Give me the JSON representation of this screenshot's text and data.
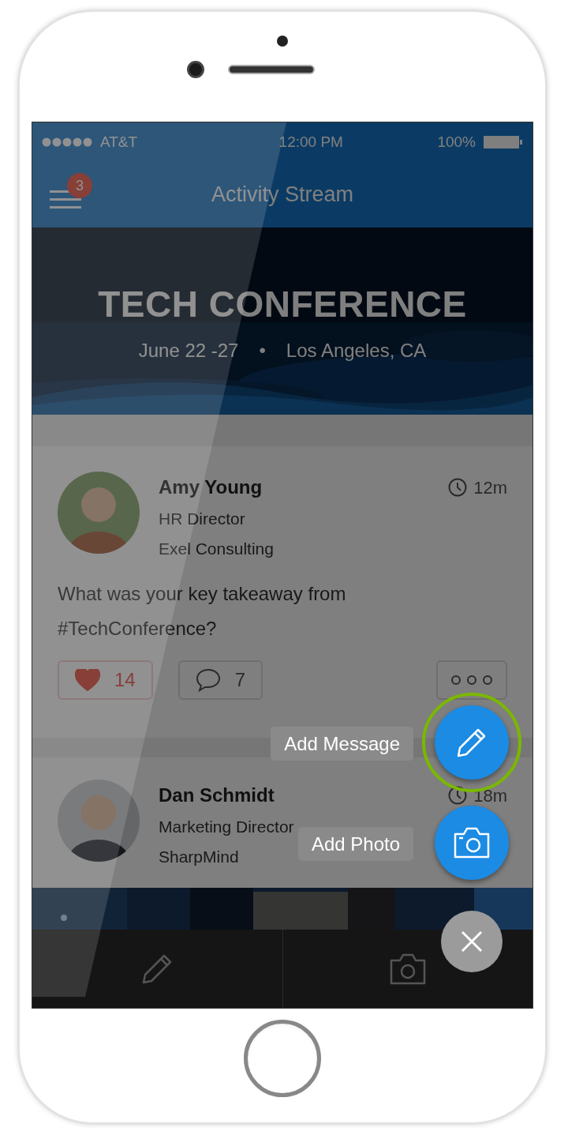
{
  "status_bar": {
    "carrier": "AT&T",
    "time": "12:00 PM",
    "battery": "100%"
  },
  "nav": {
    "title": "Activity Stream",
    "menu_badge": "3"
  },
  "banner": {
    "title": "TECH CONFERENCE",
    "dates": "June 22 -27",
    "separator": "•",
    "location": "Los Angeles, CA"
  },
  "posts": [
    {
      "name": "Amy Young",
      "role": "HR Director",
      "company": "Exel Consulting",
      "time": "12m",
      "text": "What was your key takeaway from #TechConference?",
      "likes": "14",
      "liked": true,
      "comments": "7"
    },
    {
      "name": "Dan Schmidt",
      "role": "Marketing Director",
      "company": "SharpMind",
      "time": "18m"
    }
  ],
  "fab_menu": {
    "items": [
      {
        "kind": "message",
        "label": "Add Message",
        "highlighted": true
      },
      {
        "label": "Add Photo",
        "highlighted": false
      }
    ]
  }
}
